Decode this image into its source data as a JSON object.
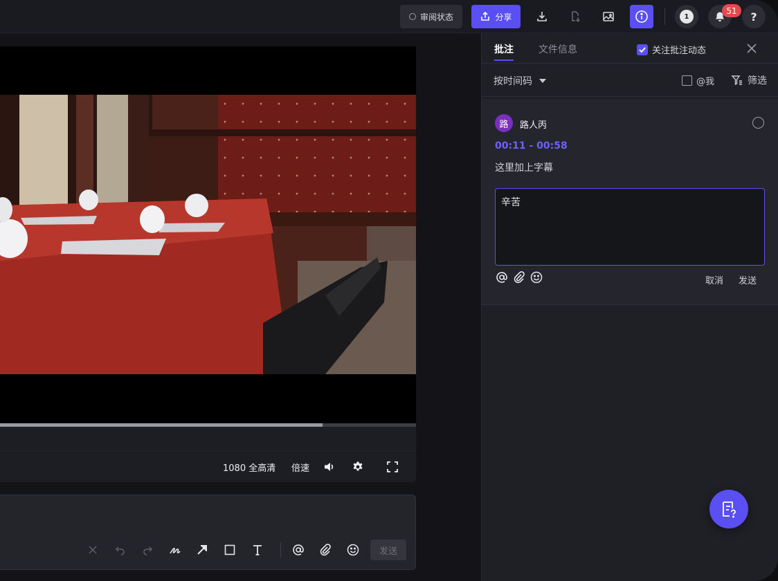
{
  "toolbar": {
    "review_status_label": "审阅状态",
    "share_label": "分享",
    "notification_count": "51",
    "help_label": "?",
    "avatar_text": "1"
  },
  "player": {
    "progress": 0.775,
    "quality_label": "1080 全高清",
    "speed_label": "倍速"
  },
  "composer": {
    "send_label": "发送"
  },
  "panel": {
    "tabs": [
      "批注",
      "文件信息"
    ],
    "follow_label": "关注批注动态",
    "follow_checked": true,
    "sort_label": "按时间码",
    "at_me_label": "@我",
    "filter_label": "筛选",
    "comment": {
      "avatar_char": "路",
      "avatar_color": "#7b2fbe",
      "user": "路人丙",
      "timecode": "00:11 - 00:58",
      "text": "这里加上字幕",
      "reply_value": "辛苦",
      "cancel_label": "取消",
      "send_label": "发送"
    }
  },
  "colors": {
    "accent": "#5a4ff2",
    "badge": "#e5484d",
    "timecode": "#6d61ff"
  }
}
